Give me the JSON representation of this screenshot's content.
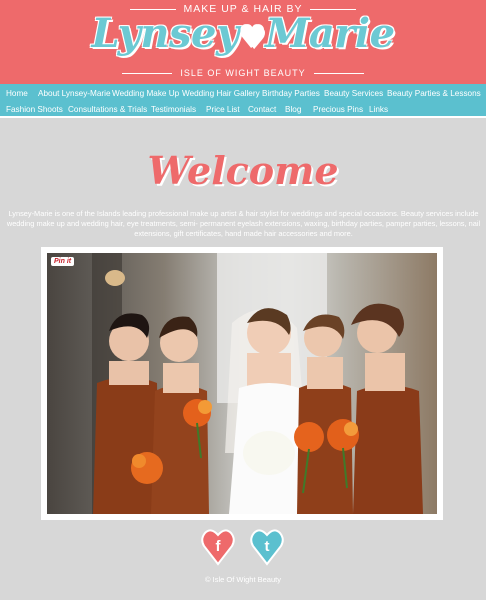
{
  "header": {
    "tagline_top": "MAKE UP & HAIR BY",
    "logo_left": "Lynsey",
    "logo_right": "Marie",
    "tagline_bottom": "ISLE OF WIGHT BEAUTY"
  },
  "nav": {
    "row1": [
      "Home",
      "About Lynsey-Marie",
      "Wedding Make Up",
      "Wedding Hair Gallery",
      "Birthday Parties",
      "Beauty Services",
      "Beauty Parties & Lessons"
    ],
    "row2": [
      "Fashion Shoots",
      "Consultations & Trials",
      "Testimonials",
      "Price List",
      "Contact",
      "Blog",
      "Precious Pins",
      "Links"
    ]
  },
  "main": {
    "heading": "Welcome",
    "intro": "Lynsey-Marie is one of the Islands leading professional make up artist & hair stylist for weddings and special occasions.   Beauty services include wedding make up and wedding hair, eye treatments, semi- permanent eyelash extensions, waxing, birthday parties, pamper parties, lessons, nail extensions, gift certificates, hand made hair accessories and more.",
    "pin_label": "Pin it"
  },
  "footer": {
    "facebook_letter": "f",
    "twitter_letter": "t",
    "copyright": "© Isle Of Wight Beauty"
  },
  "colors": {
    "coral": "#ee6a6b",
    "teal": "#5bc0cf",
    "background": "#d7d7d7"
  },
  "icons": [
    "heart-icon",
    "facebook-heart-icon",
    "twitter-heart-icon",
    "pinterest-icon"
  ]
}
